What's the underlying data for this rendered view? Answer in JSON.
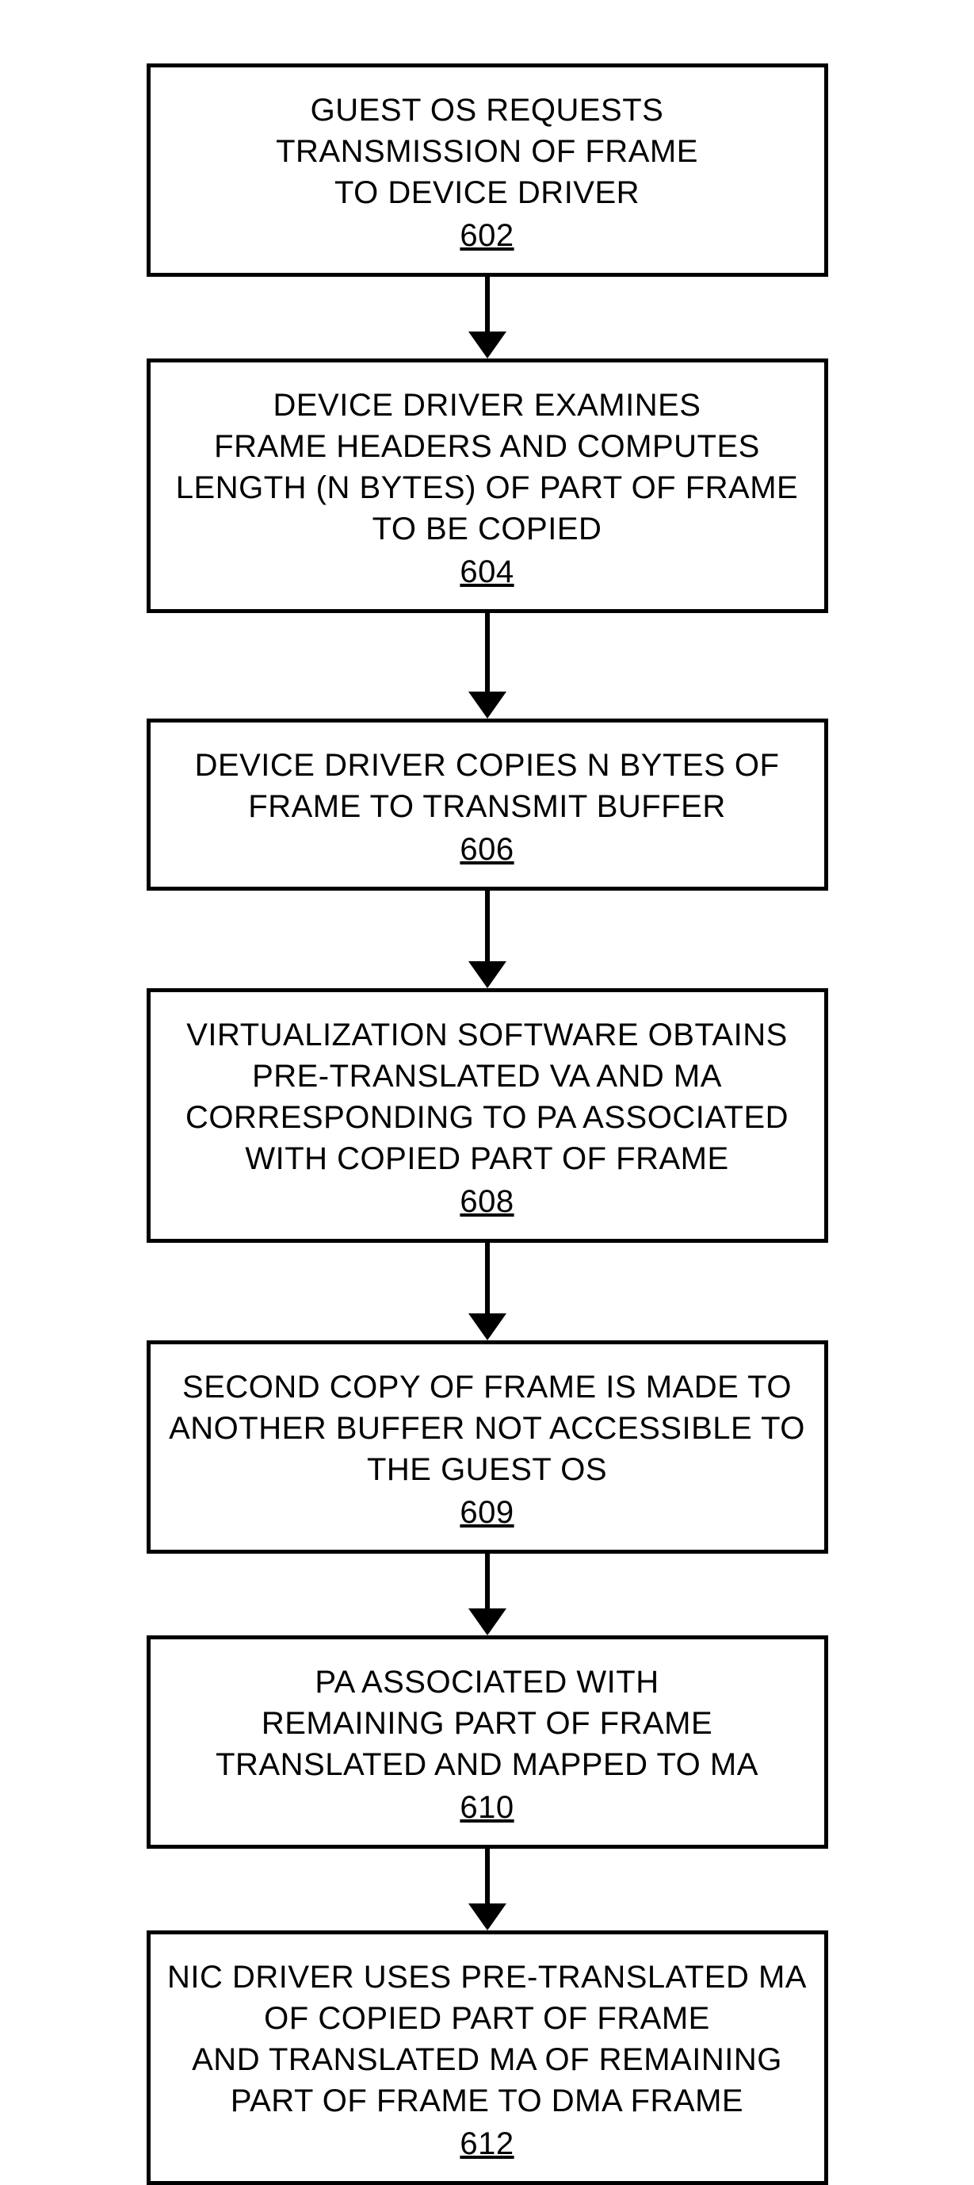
{
  "flow": {
    "boxes": [
      {
        "id": "602",
        "ref": "602",
        "lines": [
          "GUEST OS REQUESTS",
          "TRANSMISSION OF FRAME",
          "TO DEVICE DRIVER"
        ]
      },
      {
        "id": "604",
        "ref": "604",
        "lines": [
          "DEVICE DRIVER EXAMINES",
          "FRAME HEADERS AND COMPUTES",
          "LENGTH (N BYTES) OF PART OF FRAME",
          "TO BE COPIED"
        ]
      },
      {
        "id": "606",
        "ref": "606",
        "lines": [
          "DEVICE DRIVER COPIES N BYTES OF",
          "FRAME TO TRANSMIT BUFFER"
        ]
      },
      {
        "id": "608",
        "ref": "608",
        "lines": [
          "VIRTUALIZATION SOFTWARE OBTAINS",
          "PRE-TRANSLATED VA AND MA",
          "CORRESPONDING TO PA ASSOCIATED",
          "WITH COPIED PART OF FRAME"
        ]
      },
      {
        "id": "609",
        "ref": "609",
        "lines": [
          "SECOND COPY OF FRAME IS MADE TO",
          "ANOTHER BUFFER NOT ACCESSIBLE TO",
          "THE GUEST OS"
        ]
      },
      {
        "id": "610",
        "ref": "610",
        "lines": [
          "PA ASSOCIATED WITH",
          "REMAINING PART OF FRAME",
          "TRANSLATED AND MAPPED TO MA"
        ]
      },
      {
        "id": "612",
        "ref": "612",
        "lines": [
          "NIC DRIVER USES PRE-TRANSLATED MA",
          "OF COPIED PART OF FRAME",
          "AND TRANSLATED MA OF REMAINING",
          "PART OF FRAME TO DMA FRAME"
        ]
      }
    ],
    "arrow_heights": [
      70,
      100,
      90,
      90,
      70,
      70
    ]
  }
}
